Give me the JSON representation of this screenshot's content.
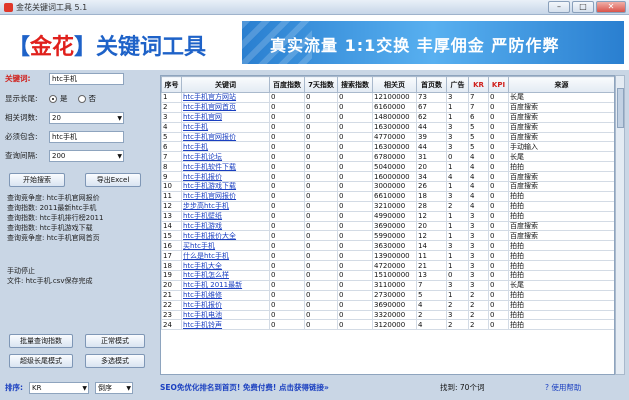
{
  "window": {
    "title": "金花关键词工具 5.1",
    "min": "–",
    "max": "□",
    "close": "✕"
  },
  "header": {
    "logo": {
      "br_open": "【",
      "name": "金花",
      "br_close": "】",
      "rest": "关键词工具"
    },
    "slogan": "真实流量 1:1交换 丰厚佣金 严防作弊"
  },
  "form": {
    "keyword_label": "关键词:",
    "keyword_value": "htc手机",
    "show_long_label": "显示长尾:",
    "yes": "是",
    "no": "否",
    "relevance_label": "相关词数:",
    "relevance_value": "20",
    "must_contain_label": "必须包含:",
    "must_contain_value": "htc手机",
    "interval_label": "查询间隔:",
    "interval_value": "200",
    "start_button": "开始搜索",
    "export_button": "导出Excel"
  },
  "log": [
    "查询竞争度: htc手机官网报价",
    "查询指数: 2011最新htc手机",
    "查询指数: htc手机排行榜2011",
    "查询指数: htc手机游戏下载",
    "查询竞争度: htc手机官网首页",
    "",
    "",
    "手动停止",
    "文件: htc手机.csv保存完成"
  ],
  "buttons": {
    "batch": "批量查询指数",
    "normal": "正常模式",
    "super_long": "超级长尾模式",
    "multi": "多选模式"
  },
  "sort": {
    "label": "排序:",
    "value": "KR",
    "order": "倒序"
  },
  "table": {
    "headers": [
      "序号",
      "关键词",
      "百度指数",
      "7天指数",
      "搜索指数",
      "相关页",
      "首页数",
      "广告",
      "KR",
      "KPI",
      "来源"
    ],
    "rows": [
      [
        "1",
        "htc手机官方网站",
        "0",
        "0",
        "0",
        "12100000",
        "73",
        "3",
        "7",
        "0",
        "长尾"
      ],
      [
        "2",
        "htc手机官网首页",
        "0",
        "0",
        "0",
        "6160000",
        "67",
        "1",
        "7",
        "0",
        "百度搜索"
      ],
      [
        "3",
        "htc手机官网",
        "0",
        "0",
        "0",
        "14800000",
        "62",
        "1",
        "6",
        "0",
        "百度搜索"
      ],
      [
        "4",
        "htc手机",
        "0",
        "0",
        "0",
        "16300000",
        "44",
        "3",
        "5",
        "0",
        "百度搜索"
      ],
      [
        "5",
        "htc手机官网报价",
        "0",
        "0",
        "0",
        "4770000",
        "39",
        "3",
        "5",
        "0",
        "百度搜索"
      ],
      [
        "6",
        "htc手机",
        "0",
        "0",
        "0",
        "16300000",
        "44",
        "3",
        "5",
        "0",
        "手动输入"
      ],
      [
        "7",
        "htc手机论坛",
        "0",
        "0",
        "0",
        "6780000",
        "31",
        "0",
        "4",
        "0",
        "长尾"
      ],
      [
        "8",
        "htc手机软件下载",
        "0",
        "0",
        "0",
        "5040000",
        "20",
        "1",
        "4",
        "0",
        "拍拍"
      ],
      [
        "9",
        "htc手机报价",
        "0",
        "0",
        "0",
        "16000000",
        "34",
        "4",
        "4",
        "0",
        "百度搜索"
      ],
      [
        "10",
        "htc手机游戏下载",
        "0",
        "0",
        "0",
        "3000000",
        "26",
        "1",
        "4",
        "0",
        "百度搜索"
      ],
      [
        "11",
        "htc手机官网报价",
        "0",
        "0",
        "0",
        "6610000",
        "18",
        "3",
        "4",
        "0",
        "拍拍"
      ],
      [
        "12",
        "步步高htc手机",
        "0",
        "0",
        "0",
        "3210000",
        "28",
        "2",
        "4",
        "0",
        "拍拍"
      ],
      [
        "13",
        "htc手机壁纸",
        "0",
        "0",
        "0",
        "4990000",
        "12",
        "1",
        "3",
        "0",
        "拍拍"
      ],
      [
        "14",
        "htc手机游戏",
        "0",
        "0",
        "0",
        "3690000",
        "20",
        "1",
        "3",
        "0",
        "百度搜索"
      ],
      [
        "15",
        "htc手机报价大全",
        "0",
        "0",
        "0",
        "5990000",
        "12",
        "1",
        "3",
        "0",
        "百度搜索"
      ],
      [
        "16",
        "买htc手机",
        "0",
        "0",
        "0",
        "3630000",
        "14",
        "3",
        "3",
        "0",
        "拍拍"
      ],
      [
        "17",
        "什么是htc手机",
        "0",
        "0",
        "0",
        "13900000",
        "11",
        "1",
        "3",
        "0",
        "拍拍"
      ],
      [
        "18",
        "htc手机大全",
        "0",
        "0",
        "0",
        "4720000",
        "21",
        "1",
        "3",
        "0",
        "拍拍"
      ],
      [
        "19",
        "htc手机怎么样",
        "0",
        "0",
        "0",
        "15100000",
        "13",
        "0",
        "3",
        "0",
        "拍拍"
      ],
      [
        "20",
        "htc手机 2011最新",
        "0",
        "0",
        "0",
        "3110000",
        "7",
        "3",
        "3",
        "0",
        "长尾"
      ],
      [
        "21",
        "htc手机维修",
        "0",
        "0",
        "0",
        "2730000",
        "5",
        "1",
        "2",
        "0",
        "拍拍"
      ],
      [
        "22",
        "htc手机报价",
        "0",
        "0",
        "0",
        "3690000",
        "4",
        "2",
        "2",
        "0",
        "拍拍"
      ],
      [
        "23",
        "htc手机电池",
        "0",
        "0",
        "0",
        "3320000",
        "2",
        "3",
        "2",
        "0",
        "拍拍"
      ],
      [
        "24",
        "htc手机铃声",
        "0",
        "0",
        "0",
        "3120000",
        "4",
        "2",
        "2",
        "0",
        "拍拍"
      ]
    ]
  },
  "status": {
    "promo": "SEO免优化排名到首页! 免费付费! 点击获得链接»",
    "found": "找到: 70个词",
    "help": "使用帮助"
  }
}
